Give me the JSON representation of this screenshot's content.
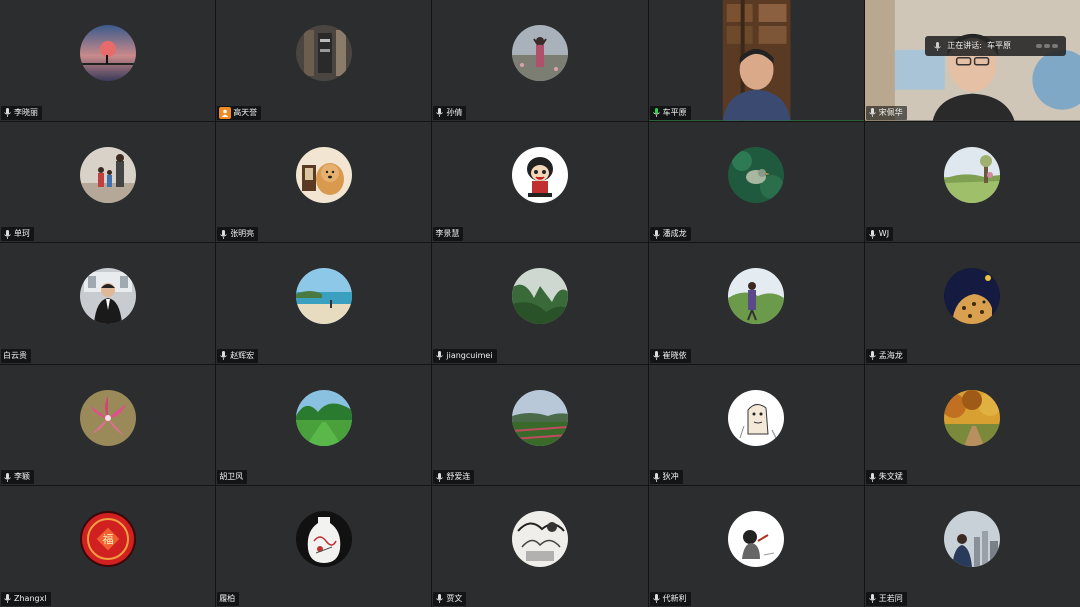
{
  "meeting": {
    "speaking_indicator": {
      "prefix": "正在讲话:",
      "speaker": "车平原"
    },
    "participants": [
      {
        "name": "李晓丽",
        "mic": true,
        "avatar": "sunset-icon"
      },
      {
        "name": "高天誉",
        "mic": false,
        "host": true,
        "avatar": "bookshelf-icon"
      },
      {
        "name": "孙倩",
        "mic": true,
        "avatar": "flower-field-icon"
      },
      {
        "name": "车平原",
        "mic": true,
        "video": true,
        "speaking": true,
        "avatar": "video-feed"
      },
      {
        "name": "宋佩华",
        "mic": true,
        "video": true,
        "avatar": "video-feed"
      },
      {
        "name": "单珂",
        "mic": true,
        "avatar": "family-icon"
      },
      {
        "name": "张明亮",
        "mic": true,
        "avatar": "dog-icon"
      },
      {
        "name": "李景慧",
        "mic": false,
        "avatar": "cartoon-icon"
      },
      {
        "name": "潘成龙",
        "mic": true,
        "avatar": "bird-icon"
      },
      {
        "name": "WJ",
        "mic": true,
        "avatar": "landscape-icon"
      },
      {
        "name": "白云贵",
        "mic": false,
        "avatar": "portrait-icon"
      },
      {
        "name": "赵辉宏",
        "mic": true,
        "avatar": "beach-icon"
      },
      {
        "name": "jiangcuimei",
        "mic": true,
        "avatar": "mountain-icon"
      },
      {
        "name": "崔晓依",
        "mic": true,
        "avatar": "person-field-icon"
      },
      {
        "name": "孟海龙",
        "mic": true,
        "avatar": "leopard-icon"
      },
      {
        "name": "李颖",
        "mic": true,
        "avatar": "lily-icon"
      },
      {
        "name": "胡卫风",
        "mic": false,
        "avatar": "lawn-icon"
      },
      {
        "name": "舒爱连",
        "mic": true,
        "avatar": "field-icon"
      },
      {
        "name": "狄冲",
        "mic": true,
        "avatar": "sketch-icon"
      },
      {
        "name": "朱文斌",
        "mic": true,
        "avatar": "autumn-icon"
      },
      {
        "name": "Zhangxl",
        "mic": true,
        "avatar": "fu-icon"
      },
      {
        "name": "履柏",
        "mic": false,
        "avatar": "vase-icon"
      },
      {
        "name": "贾文",
        "mic": true,
        "avatar": "ink-icon"
      },
      {
        "name": "代新利",
        "mic": true,
        "avatar": "ink-figure-icon"
      },
      {
        "name": "王若同",
        "mic": true,
        "avatar": "city-icon"
      }
    ]
  },
  "colors": {
    "tile_bg": "#2b2d2f",
    "speaking_border": "#2bb04a",
    "host_badge": "#f08a24"
  }
}
